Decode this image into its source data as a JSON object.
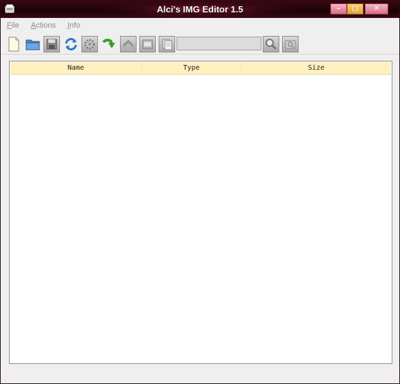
{
  "window": {
    "title": "Alci's IMG Editor 1.5",
    "minimize_symbol": "–",
    "maximize_symbol": "□",
    "close_symbol": "✕"
  },
  "menu": [
    {
      "first": "F",
      "rest": "ile"
    },
    {
      "first": "A",
      "rest": "ctions"
    },
    {
      "first": "I",
      "rest": "nfo"
    }
  ],
  "toolbar": {
    "icons": [
      "new-file-icon",
      "open-folder-icon",
      "save-icon",
      "refresh-icon",
      "settings-gear-icon",
      "import-arrow-icon",
      "export-icon",
      "add-icon",
      "copy-icon",
      "search-icon",
      "find-icon"
    ],
    "search_value": ""
  },
  "table": {
    "columns": [
      "Name",
      "Type",
      "Size"
    ],
    "rows": []
  },
  "colors": {
    "titlebar": "#2a040b",
    "header_bg": "#fff0c0",
    "window_bg": "#efefef"
  }
}
